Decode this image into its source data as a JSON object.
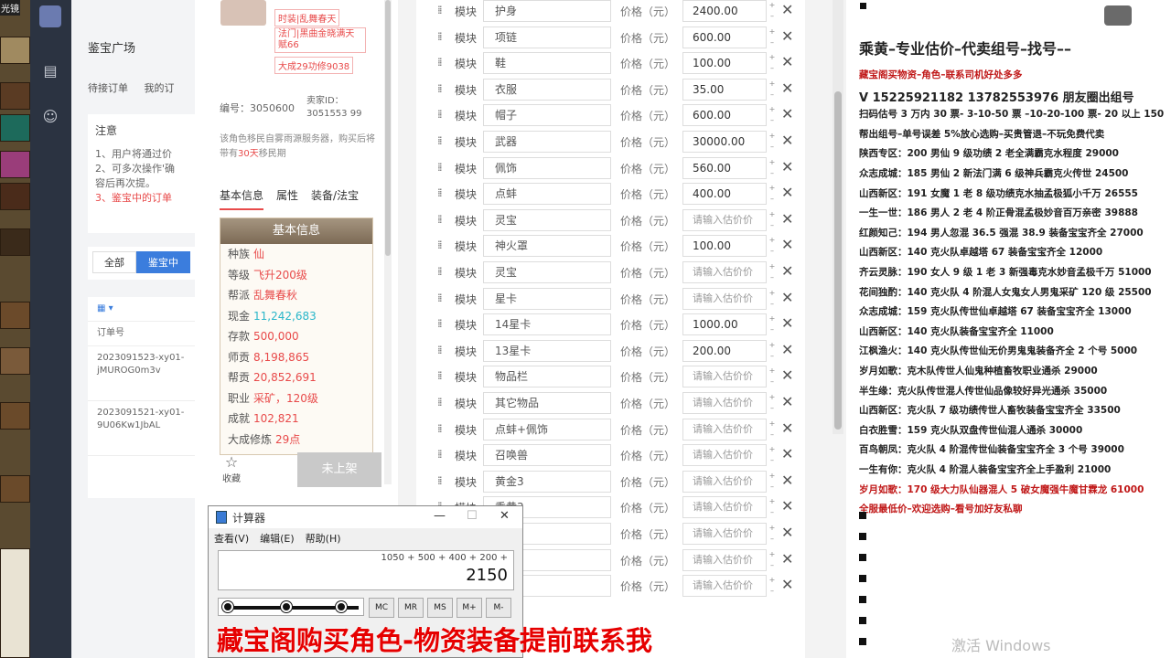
{
  "game": {
    "label": "光镜"
  },
  "admin": {
    "title": "鉴宝广场",
    "tabs": [
      "待接订单",
      "我的订"
    ],
    "notice_title": "注意",
    "notice_lines": [
      "1、用户将通过价",
      "2、可多次操作'确",
      "容后再次提。",
      "3、鉴宝中的订单"
    ],
    "filter": [
      "全部",
      "鉴宝中"
    ],
    "table_header": "订单号",
    "orders": [
      "2023091523-xy01-jMUROG0m3v",
      "2023091521-xy01-9U06Kw1JbAL"
    ]
  },
  "detail": {
    "tags": [
      "时装|乱舞春天",
      "法门|黑曲金晓满天赋66",
      "大成29功修9038"
    ],
    "id_label": "编号：3050600",
    "seller_label": "卖家ID：3051553 99",
    "warning": "该角色移民自雾雨源服务器，购买后将带有",
    "warning_days": "30天",
    "warning_tail": "移民期",
    "subtabs": [
      "基本信息",
      "属性",
      "装备/法宝"
    ],
    "info_head": "基本信息",
    "rows": [
      {
        "k": "种族",
        "v": "仙",
        "c": "red"
      },
      {
        "k": "等级",
        "v": "飞升200级",
        "c": "red"
      },
      {
        "k": "帮派",
        "v": "乱舞春秋",
        "c": "red"
      },
      {
        "k": "现金",
        "v": "11,242,683",
        "c": "cyan"
      },
      {
        "k": "存款",
        "v": "500,000",
        "c": "red"
      },
      {
        "k": "师贡",
        "v": "8,198,865",
        "c": "red"
      },
      {
        "k": "帮贡",
        "v": "20,852,691",
        "c": "red"
      },
      {
        "k": "职业",
        "v": "采矿，120级",
        "c": "red"
      },
      {
        "k": "成就",
        "v": "102,821",
        "c": "red"
      },
      {
        "k": "大成修炼",
        "v": "29点",
        "c": "red"
      }
    ],
    "fav": "收藏",
    "unlisted": "未上架"
  },
  "form": {
    "module_label": "模块",
    "price_label": "价格（元）",
    "placeholder": "请输入估价价",
    "rows": [
      {
        "name": "护身",
        "price": "2400.00"
      },
      {
        "name": "项链",
        "price": "600.00"
      },
      {
        "name": "鞋",
        "price": "100.00"
      },
      {
        "name": "衣服",
        "price": "35.00"
      },
      {
        "name": "帽子",
        "price": "600.00"
      },
      {
        "name": "武器",
        "price": "30000.00"
      },
      {
        "name": "佩饰",
        "price": "560.00"
      },
      {
        "name": "点蚌",
        "price": "400.00"
      },
      {
        "name": "灵宝",
        "price": ""
      },
      {
        "name": "神火罩",
        "price": "100.00"
      },
      {
        "name": "灵宝",
        "price": ""
      },
      {
        "name": "星卡",
        "price": ""
      },
      {
        "name": "14星卡",
        "price": "1000.00"
      },
      {
        "name": "13星卡",
        "price": "200.00"
      },
      {
        "name": "物品栏",
        "price": ""
      },
      {
        "name": "其它物品",
        "price": ""
      },
      {
        "name": "点蚌+佩饰",
        "price": ""
      },
      {
        "name": "召唤兽",
        "price": ""
      },
      {
        "name": "黄金3",
        "price": ""
      },
      {
        "name": "乘黄3",
        "price": ""
      },
      {
        "name": "",
        "price": ""
      },
      {
        "name": "",
        "price": ""
      },
      {
        "name": "",
        "price": ""
      }
    ]
  },
  "calc": {
    "title": "计算器",
    "menu": [
      "查看(V)",
      "编辑(E)",
      "帮助(H)"
    ],
    "expression": "1050 + 500 + 400 + 200 +",
    "result": "2150",
    "mem_buttons": [
      "MC",
      "MR",
      "MS",
      "M+",
      "M-"
    ]
  },
  "caption": "藏宝阁购买角色-物资装备提前联系我",
  "ad": {
    "heading": "乘黄–专业估价–代卖组号–找号––",
    "lines": [
      {
        "t": "藏宝阁买物资–角色–联系司机好处多多",
        "c": "red"
      },
      {
        "t": "V 15225921182   13782553976 朋友圈出组号",
        "c": "big"
      },
      {
        "t": "扫码估号 3 万内 30 票- 3-10-50 票 –10-20-100 票- 20 以上 150",
        "c": ""
      },
      {
        "t": "帮出组号–单号误差 5%放心选购–买贵管退–不玩免费代卖",
        "c": ""
      },
      {
        "t": "陕西专区：200 男仙 9 级功绩 2 老全满霸克水程度 29000",
        "c": ""
      },
      {
        "t": "众志成城：185 男仙 2 新法门满 6 级神兵霸克火传世 24500",
        "c": ""
      },
      {
        "t": "山西新区：191 女魔 1 老 8 级功绩克水抽孟极狐小千万 26555",
        "c": ""
      },
      {
        "t": "一生一世：186 男人 2 老 4 阶正骨混孟极妙音百万亲密 39888",
        "c": ""
      },
      {
        "t": "红颜知己：194 男人忽混 36.5 强混 38.9 装备宝宝齐全 27000",
        "c": ""
      },
      {
        "t": "山西新区：140 克火队卓越塔 67 装备宝宝齐全 12000",
        "c": ""
      },
      {
        "t": "齐云灵脉：190 女人 9 级 1 老 3 新强毒克水妙音孟极千万 51000",
        "c": ""
      },
      {
        "t": "花间独酌：140 克火队 4 阶混人女鬼女人男鬼采矿 120 级 25500",
        "c": ""
      },
      {
        "t": "众志成城：159 克火队传世仙卓越塔 67 装备宝宝齐全 13000",
        "c": ""
      },
      {
        "t": "山西新区：140 克火队装备宝宝齐全 11000",
        "c": ""
      },
      {
        "t": "江枫渔火：140 克火队传世仙无价男鬼鬼装备齐全 2 个号 5000",
        "c": ""
      },
      {
        "t": "岁月如歌：克木队传世人仙鬼种植畜牧职业通杀 29000",
        "c": ""
      },
      {
        "t": "半生缘：克火队传世混人传世仙品像较好异光通杀 35000",
        "c": ""
      },
      {
        "t": "山西新区：克火队 7 级功绩传世人畜牧装备宝宝齐全 33500",
        "c": ""
      },
      {
        "t": "白衣胜雪：159 克火队双盘传世仙混人通杀 30000",
        "c": ""
      },
      {
        "t": "百鸟朝凤：克火队 4 阶混传世仙装备宝宝齐全 3 个号 39000",
        "c": ""
      },
      {
        "t": "一生有你：克火队 4 阶混人装备宝宝齐全上手盈利 21000",
        "c": ""
      },
      {
        "t": "岁月如歌：170 级大力队仙器混人 5 破女魔强牛魔甘霖龙 61000",
        "c": "red"
      },
      {
        "t": "全服最低价–欢迎选购–看号加好友私聊",
        "c": "red"
      }
    ],
    "watermark": "激活 Windows"
  }
}
